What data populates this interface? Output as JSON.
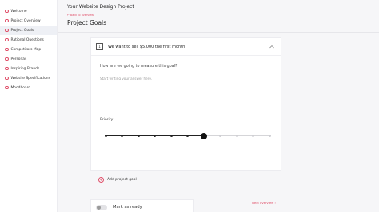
{
  "sidebar": {
    "items": [
      {
        "label": "Welcome",
        "active": false
      },
      {
        "label": "Project Overview",
        "active": false
      },
      {
        "label": "Project Goals",
        "active": true
      },
      {
        "label": "Rational Questions",
        "active": false
      },
      {
        "label": "Competitors Map",
        "active": false
      },
      {
        "label": "Personas",
        "active": false
      },
      {
        "label": "Inspiring Brands",
        "active": false
      },
      {
        "label": "Website Specifications",
        "active": false
      },
      {
        "label": "Moodboard",
        "active": false
      }
    ]
  },
  "header": {
    "project_title": "Your Website Design Project",
    "back_link": "← Back to overview",
    "page_title": "Project Goals"
  },
  "goal": {
    "number": "1",
    "text": "We want to sell $5.000 the first month",
    "question": "How are we going to measure this goal?",
    "answer_placeholder": "Start writing your answer here.",
    "priority_label": "Priority",
    "priority_value": 7,
    "priority_max": 11
  },
  "actions": {
    "add_goal_label": "Add project goal",
    "mark_ready_label": "Mark as ready",
    "next_link": "Next overview ›"
  },
  "colors": {
    "accent": "#e0506a",
    "text": "#222222",
    "background": "#f6f6f8"
  }
}
